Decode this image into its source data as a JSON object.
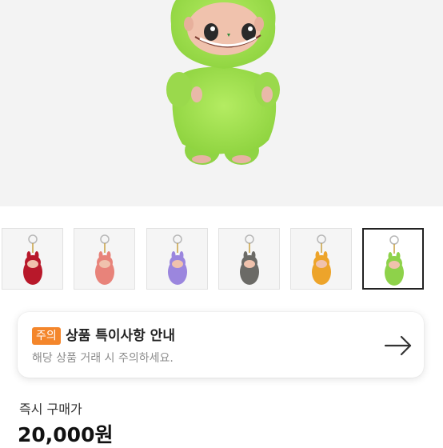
{
  "product": {
    "main_image": "green-plush-doll-image",
    "thumbnails": [
      {
        "name": "red-variant",
        "color": "#b8182a"
      },
      {
        "name": "pink-variant",
        "color": "#e8837a"
      },
      {
        "name": "purple-variant",
        "color": "#9b86de"
      },
      {
        "name": "gray-variant",
        "color": "#6b6a66"
      },
      {
        "name": "orange-variant",
        "color": "#eda42a"
      },
      {
        "name": "green-variant",
        "color": "#8ed24a"
      }
    ],
    "selected_thumbnail": 5
  },
  "notice": {
    "badge": "주의",
    "title": "상품 특이사항 안내",
    "description": "해당 상품 거래 시 주의하세요.",
    "arrow_icon": "arrow-right-icon",
    "badge_color": "#f4862b"
  },
  "price": {
    "label": "즉시 구매가",
    "value": "20,000원"
  }
}
